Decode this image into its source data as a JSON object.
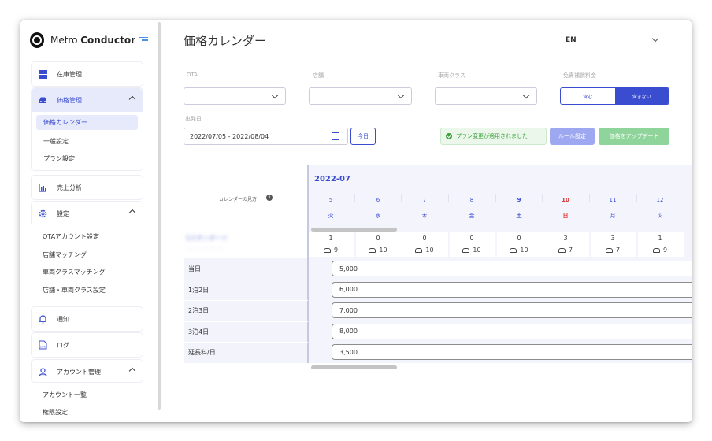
{
  "app": {
    "brand_light": "Metro ",
    "brand_bold": "Conductor",
    "language": "EN"
  },
  "sidebar": {
    "inventory": "在庫管理",
    "pricing": {
      "label": "価格管理",
      "items": [
        "価格カレンダー",
        "一般設定",
        "プラン設定"
      ]
    },
    "sales": "売上分析",
    "settings": {
      "label": "設定",
      "items": [
        "OTAアカウント設定",
        "店舗マッチング",
        "車両クラスマッチング",
        "店舗・車両クラス設定"
      ]
    },
    "notifications": "通知",
    "logs": "ログ",
    "account": {
      "label": "アカウント管理",
      "items": [
        "アカウント一覧",
        "権限設定"
      ]
    }
  },
  "page": {
    "title": "価格カレンダー"
  },
  "filters": {
    "ota_label": "OTA",
    "store_label": "店舗",
    "class_label": "車両クラス",
    "insurance_label": "免責補償料金",
    "insurance_on": "含む",
    "insurance_off": "含まない",
    "date_label": "出発日",
    "date_value": "2022/07/05 - 2022/08/04",
    "today": "今日"
  },
  "actions": {
    "status": "プラン変更が適用されました",
    "rules": "ルール設定",
    "update": "価格をアップデート"
  },
  "calendar": {
    "how_to_read": "カレンダーの見方",
    "help": "?",
    "month": "2022-07",
    "blurred_title": "Sスタンダード",
    "blurred_sub": "・・・・・・・・",
    "days": [
      {
        "d": "5",
        "w": "火",
        "avail": "1",
        "cars": "9"
      },
      {
        "d": "6",
        "w": "水",
        "avail": "0",
        "cars": "10"
      },
      {
        "d": "7",
        "w": "木",
        "avail": "0",
        "cars": "10"
      },
      {
        "d": "8",
        "w": "金",
        "avail": "0",
        "cars": "10"
      },
      {
        "d": "9",
        "w": "土",
        "avail": "0",
        "cars": "10"
      },
      {
        "d": "10",
        "w": "日",
        "avail": "3",
        "cars": "7"
      },
      {
        "d": "11",
        "w": "月",
        "avail": "3",
        "cars": "7"
      },
      {
        "d": "12",
        "w": "火",
        "avail": "1",
        "cars": "9"
      }
    ],
    "rows": [
      {
        "label": "当日",
        "price": "5,000"
      },
      {
        "label": "1泊2日",
        "price": "6,000"
      },
      {
        "label": "2泊3日",
        "price": "7,000"
      },
      {
        "label": "3泊4日",
        "price": "8,000"
      },
      {
        "label": "延長料/日",
        "price": "3,500"
      }
    ]
  },
  "colors": {
    "accent": "#3a4ccf",
    "success": "#3aa13a",
    "sunday": "#e03030"
  }
}
